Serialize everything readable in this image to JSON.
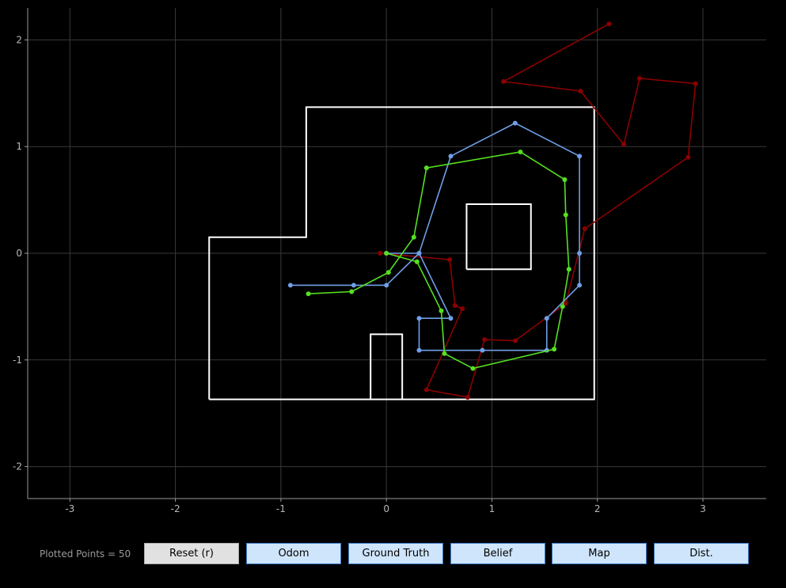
{
  "chart_data": {
    "type": "line",
    "xlim": [
      -3.4,
      3.6
    ],
    "ylim": [
      -2.3,
      2.3
    ],
    "x_ticks": [
      -3,
      -2,
      -1,
      0,
      1,
      2,
      3
    ],
    "y_ticks": [
      2,
      1,
      0,
      -1,
      -2
    ],
    "grid": true,
    "map_segments": [
      [
        [
          -1.68,
          -1.37
        ],
        [
          1.97,
          -1.37
        ],
        [
          1.97,
          1.37
        ],
        [
          -0.76,
          1.37
        ],
        [
          -0.76,
          0.15
        ],
        [
          -1.68,
          0.15
        ],
        [
          -1.68,
          -1.37
        ]
      ],
      [
        [
          0.76,
          -0.15
        ],
        [
          1.37,
          -0.15
        ],
        [
          1.37,
          0.46
        ],
        [
          0.76,
          0.46
        ],
        [
          0.76,
          -0.15
        ]
      ],
      [
        [
          -0.15,
          -1.37
        ],
        [
          -0.15,
          -0.76
        ],
        [
          0.15,
          -0.76
        ],
        [
          0.15,
          -1.37
        ]
      ]
    ],
    "series": [
      {
        "color": "#8b0000",
        "points": [
          [
            -0.06,
            0.0
          ],
          [
            0.6,
            -0.06
          ],
          [
            0.65,
            -0.49
          ],
          [
            0.72,
            -0.52
          ],
          [
            0.38,
            -1.28
          ],
          [
            0.77,
            -1.35
          ],
          [
            0.93,
            -0.81
          ],
          [
            1.22,
            -0.82
          ],
          [
            1.7,
            -0.47
          ],
          [
            1.88,
            0.23
          ],
          [
            2.86,
            0.9
          ],
          [
            2.93,
            1.59
          ],
          [
            2.4,
            1.64
          ],
          [
            2.25,
            1.02
          ],
          [
            1.84,
            1.52
          ],
          [
            1.11,
            1.61
          ],
          [
            2.11,
            2.15
          ]
        ]
      },
      {
        "color": "#6f9fe8",
        "points": [
          [
            -0.91,
            -0.3
          ],
          [
            -0.31,
            -0.3
          ],
          [
            0.0,
            -0.3
          ],
          [
            0.31,
            0.0
          ],
          [
            0.61,
            0.91
          ],
          [
            1.22,
            1.22
          ],
          [
            1.83,
            0.91
          ],
          [
            1.83,
            0.0
          ],
          [
            1.83,
            -0.3
          ],
          [
            1.52,
            -0.61
          ],
          [
            1.52,
            -0.91
          ],
          [
            0.91,
            -0.91
          ],
          [
            0.31,
            -0.91
          ],
          [
            0.31,
            -0.61
          ],
          [
            0.61,
            -0.61
          ],
          [
            0.31,
            0.0
          ],
          [
            0.0,
            0.0
          ]
        ]
      },
      {
        "color": "#55e020",
        "points": [
          [
            0.0,
            0.0
          ],
          [
            0.29,
            -0.08
          ],
          [
            0.52,
            -0.54
          ],
          [
            0.55,
            -0.94
          ],
          [
            0.82,
            -1.08
          ],
          [
            1.59,
            -0.9
          ],
          [
            1.67,
            -0.5
          ],
          [
            1.73,
            -0.15
          ],
          [
            1.7,
            0.36
          ],
          [
            1.69,
            0.69
          ],
          [
            1.27,
            0.95
          ],
          [
            0.38,
            0.8
          ],
          [
            0.26,
            0.15
          ],
          [
            0.02,
            -0.18
          ],
          [
            -0.33,
            -0.36
          ],
          [
            -0.74,
            -0.38
          ]
        ]
      }
    ]
  },
  "status": {
    "plotted_points": "Plotted Points = 50"
  },
  "buttons": {
    "reset": "Reset (r)",
    "odom": "Odom",
    "ground_truth": "Ground Truth",
    "belief": "Belief",
    "map": "Map",
    "dist": "Dist."
  }
}
